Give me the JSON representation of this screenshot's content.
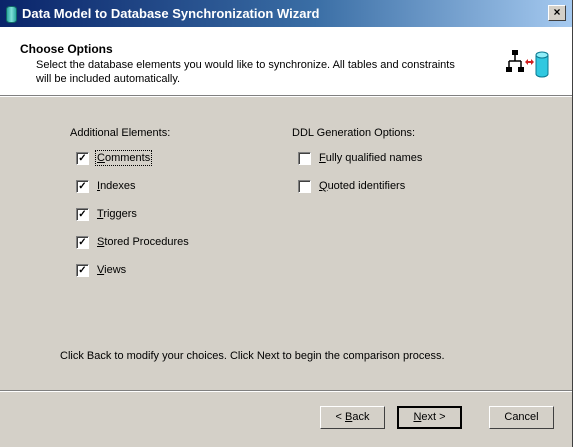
{
  "window": {
    "title": "Data Model to Database Synchronization Wizard",
    "close_label": "×"
  },
  "header": {
    "title": "Choose Options",
    "description": "Select the database elements you would like to synchronize.  All tables and constraints will be included automatically.",
    "icon": "network-database-sync-icon"
  },
  "additional": {
    "label": "Additional Elements:",
    "items": [
      {
        "label": "Comments",
        "checked": true,
        "mnemonic": "C",
        "rest": "omments"
      },
      {
        "label": "Indexes",
        "checked": true,
        "mnemonic": "I",
        "rest": "ndexes"
      },
      {
        "label": "Triggers",
        "checked": true,
        "mnemonic": "T",
        "rest": "riggers"
      },
      {
        "label": "Stored Procedures",
        "checked": true,
        "mnemonic": "S",
        "rest": "tored Procedures"
      },
      {
        "label": "Views",
        "checked": true,
        "mnemonic": "V",
        "rest": "iews"
      }
    ]
  },
  "ddl": {
    "label": "DDL Generation Options:",
    "items": [
      {
        "label": "Fully qualified names",
        "checked": false,
        "mnemonic": "F",
        "rest": "ully qualified names"
      },
      {
        "label": "Quoted identifiers",
        "checked": false,
        "mnemonic": "Q",
        "rest": "uoted identifiers"
      }
    ]
  },
  "footer_text": "Click Back to modify your choices. Click Next to begin the comparison process.",
  "buttons": {
    "back": {
      "pre": "< ",
      "mnemonic": "B",
      "rest": "ack"
    },
    "next": {
      "pre": "",
      "mnemonic": "N",
      "rest": "ext >"
    },
    "cancel": {
      "label": "Cancel"
    }
  },
  "colors": {
    "dialog_bg": "#d4d0c8",
    "title_start": "#0a246a",
    "title_end": "#a6caf0"
  },
  "check_mark": "✓"
}
